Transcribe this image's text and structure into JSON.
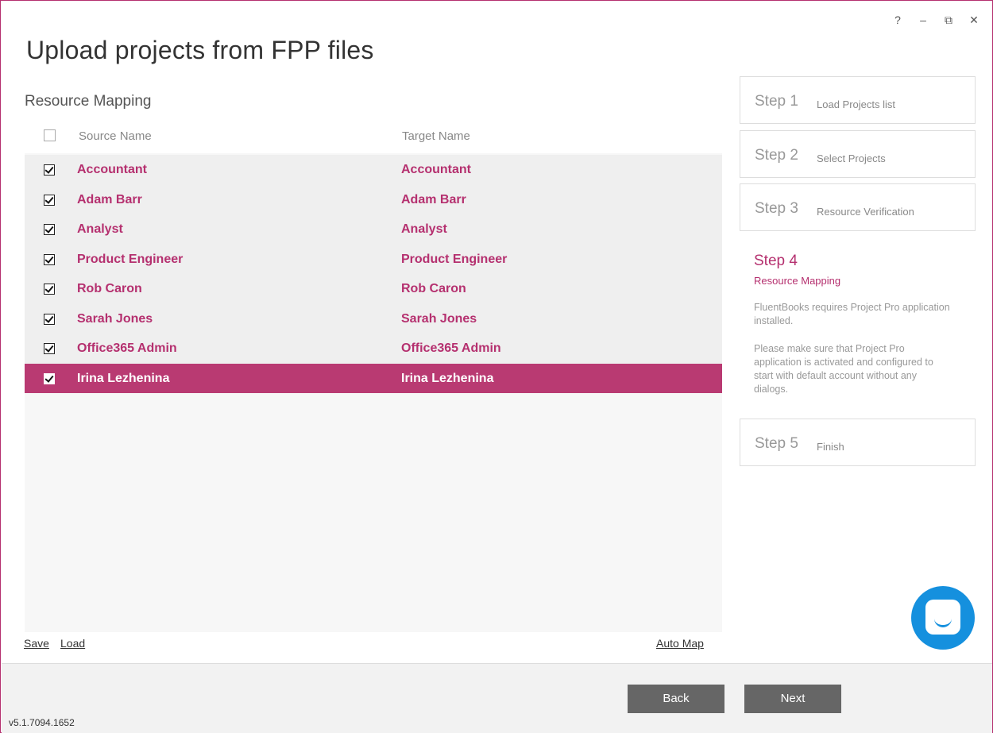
{
  "window": {
    "controls": [
      "?",
      "–",
      "⧉",
      "✕"
    ]
  },
  "page_title": "Upload projects from FPP files",
  "section_title": "Resource Mapping",
  "grid": {
    "headers": {
      "source": "Source Name",
      "target": "Target Name"
    },
    "rows": [
      {
        "source": "Accountant",
        "target": "Accountant",
        "checked": true
      },
      {
        "source": "Adam Barr",
        "target": "Adam Barr",
        "checked": true
      },
      {
        "source": "Analyst",
        "target": "Analyst",
        "checked": true
      },
      {
        "source": "Product Engineer",
        "target": "Product Engineer",
        "checked": true
      },
      {
        "source": "Rob Caron",
        "target": "Rob Caron",
        "checked": true
      },
      {
        "source": "Sarah Jones",
        "target": "Sarah Jones",
        "checked": true
      },
      {
        "source": "Office365 Admin",
        "target": "Office365 Admin",
        "checked": true
      },
      {
        "source": "Irina Lezhenina",
        "target": "Irina Lezhenina",
        "checked": true,
        "selected": true
      }
    ]
  },
  "links": {
    "save": "Save",
    "load": "Load",
    "auto_map": "Auto Map"
  },
  "steps": {
    "step1": {
      "num": "Step 1",
      "desc": "Load Projects list"
    },
    "step2": {
      "num": "Step 2",
      "desc": "Select Projects"
    },
    "step3": {
      "num": "Step 3",
      "desc": "Resource Verification"
    },
    "step4": {
      "num": "Step 4",
      "desc": "Resource Mapping",
      "note1": "FluentBooks requires Project Pro application installed.",
      "note2": "Please make sure that Project Pro application is activated and configured to start with default account without any dialogs."
    },
    "step5": {
      "num": "Step 5",
      "desc": "Finish"
    }
  },
  "footer": {
    "back": "Back",
    "next": "Next",
    "version": "v5.1.7094.1652"
  },
  "colors": {
    "accent": "#b5306f",
    "selected_row": "#b93a72",
    "chat": "#1590de",
    "button": "#666666"
  },
  "icons": {
    "chat": "chat-bubble-icon",
    "help": "help-icon",
    "minimize": "minimize-icon",
    "restore": "restore-icon",
    "close": "close-icon"
  }
}
